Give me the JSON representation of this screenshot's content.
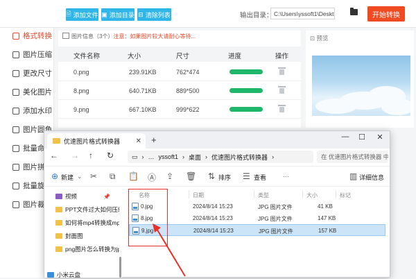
{
  "toolbar": {
    "add_file": "添加文件",
    "add_folder": "添加目录",
    "clear_list": "清除列表",
    "output_label": "输出目录：",
    "output_path": "C:\\Users\\yssoft1\\Deskt",
    "start_button": "开始转换"
  },
  "sidebar": {
    "items": [
      {
        "label": "格式转换",
        "active": true
      },
      {
        "label": "图片压缩"
      },
      {
        "label": "更改尺寸"
      },
      {
        "label": "美化图片"
      },
      {
        "label": "添加水印"
      },
      {
        "label": "图片圆角"
      },
      {
        "label": "批量命"
      },
      {
        "label": "图片拼"
      },
      {
        "label": "批量旋"
      },
      {
        "label": "图片裁"
      }
    ]
  },
  "file_panel": {
    "info_prefix": "图片信息（3个）",
    "info_warning": "注意：如果图片较大请耐心等待...",
    "columns": [
      "文件名称",
      "大小",
      "尺寸",
      "进度",
      "操作"
    ],
    "rows": [
      {
        "name": "0.png",
        "size": "239.91KB",
        "dims": "762*474",
        "progress": 1.0
      },
      {
        "name": "8.png",
        "size": "640.71KB",
        "dims": "889*500",
        "progress": 1.0
      },
      {
        "name": "9.png",
        "size": "667.10KB",
        "dims": "999*622",
        "progress": 1.0
      }
    ]
  },
  "preview": {
    "label": "预览"
  },
  "explorer": {
    "tab_title": "优速图片格式转换器",
    "breadcrumb": [
      "…",
      "yssoft1",
      "桌面",
      "优速图片格式转换器"
    ],
    "search_placeholder": "在 优速图片格式转换器 中搜",
    "new_label": "新建",
    "sort_label": "排序",
    "view_label": "查看",
    "details_label": "详细信息",
    "nav_items": [
      {
        "label": "视频",
        "pinned": true
      },
      {
        "label": "PPT文件过大如何压缩处"
      },
      {
        "label": "如何将mp4转换成mp3"
      },
      {
        "label": "封面图"
      },
      {
        "label": "png图片怎么转换为jpg"
      },
      {
        "label": "小米云盘"
      }
    ],
    "columns": [
      "名称",
      "日期",
      "类型",
      "大小",
      "标记"
    ],
    "files": [
      {
        "name": "0.jpg",
        "date": "2024/8/14 15:23",
        "type": "JPG 图片文件",
        "size": "41 KB"
      },
      {
        "name": "8.jpg",
        "date": "2024/8/14 15:23",
        "type": "JPG 图片文件",
        "size": "147 KB"
      },
      {
        "name": "9.jpg",
        "date": "2024/8/14 15:23",
        "type": "JPG 图片文件",
        "size": "157 KB",
        "selected": true
      }
    ]
  },
  "colors": {
    "accent": "#f04a23",
    "blue_button": "#2fb5e8",
    "progress": "#1fb86a",
    "highlight_box": "#e8302a"
  }
}
